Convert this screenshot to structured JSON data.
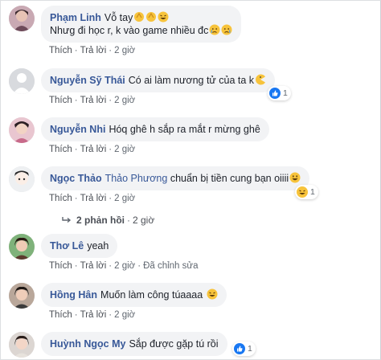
{
  "comments": [
    {
      "author": "Phạm Linh",
      "text_line1": "Vỗ tay",
      "text_line2": "Nhưg đi học r, k vào game nhiều đc",
      "emoji1": "clap-emoji",
      "emoji2": "laughing-emoji",
      "emoji3": "crying-emoji",
      "actions": {
        "like": "Thích",
        "reply": "Trả lời",
        "time": "2 giờ"
      }
    },
    {
      "author": "Nguyễn Sỹ Thái",
      "text": "Có ai làm nương tử của ta k",
      "emoji": "pacman-emoji",
      "reaction_count": "1",
      "actions": {
        "like": "Thích",
        "reply": "Trả lời",
        "time": "2 giờ"
      }
    },
    {
      "author": "Nguyễn Nhi",
      "text": "Hóq ghê h sắp ra mắt r mừng ghê",
      "actions": {
        "like": "Thích",
        "reply": "Trả lời",
        "time": "2 giờ"
      }
    },
    {
      "author": "Ngọc Thảo",
      "tag": "Thảo Phương",
      "text": "chuẩn bị tiền cung bạn oiiii",
      "emoji": "grinning-emoji",
      "reaction_count": "1",
      "actions": {
        "like": "Thích",
        "reply": "Trả lời",
        "time": "2 giờ"
      },
      "replies": {
        "label": "2 phản hồi",
        "time": "2 giờ"
      }
    },
    {
      "author": "Thơ Lê",
      "text": "yeah",
      "actions": {
        "like": "Thích",
        "reply": "Trả lời",
        "time": "2 giờ",
        "edited": "Đã chỉnh sửa"
      }
    },
    {
      "author": "Hồng Hân",
      "text": "Muốn làm công túaaaa",
      "emoji": "laughing-emoji",
      "actions": {
        "like": "Thích",
        "reply": "Trả lời",
        "time": "2 giờ"
      }
    },
    {
      "author": "Huỳnh Ngọc My",
      "text": "Sắp được gặp tú rồi",
      "reaction_count": "1"
    }
  ],
  "colors": {
    "link_blue": "#385898",
    "bubble_bg": "#f2f3f5",
    "meta_gray": "#606770",
    "like_blue": "#1877f2",
    "emoji_yellow": "#f7c33b"
  }
}
